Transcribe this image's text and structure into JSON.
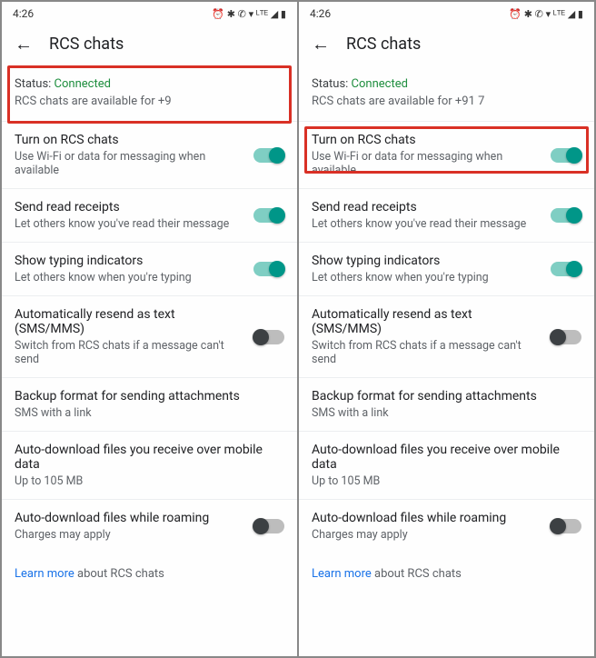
{
  "statusbar": {
    "time": "4:26",
    "icons": "⏰ ✱ ✆ ▾ ᴸᵀᴱ ◢ ▮"
  },
  "header": {
    "title": "RCS chats"
  },
  "status": {
    "label": "Status: ",
    "value": "Connected",
    "sub_left": "RCS chats are available for +9",
    "sub_right": "RCS chats are available for +91 7"
  },
  "rows": {
    "turn_on": {
      "title": "Turn on RCS chats",
      "sub": "Use Wi-Fi or data for messaging when available",
      "on": true
    },
    "read_receipts": {
      "title": "Send read receipts",
      "sub": "Let others know you've read their message",
      "on": true
    },
    "typing": {
      "title": "Show typing indicators",
      "sub": "Let others know when you're typing",
      "on": true
    },
    "auto_resend": {
      "title": "Automatically resend as text (SMS/MMS)",
      "sub": "Switch from RCS chats if a message can't send",
      "on": false
    },
    "backup": {
      "title": "Backup format for sending attachments",
      "sub": "SMS with a link"
    },
    "autodl": {
      "title": "Auto-download files you receive over mobile data",
      "sub": "Up to 105 MB"
    },
    "autodl_roam": {
      "title": "Auto-download files while roaming",
      "sub": "Charges may apply",
      "on": false
    }
  },
  "learn": {
    "link": "Learn more",
    "rest": " about RCS chats"
  }
}
